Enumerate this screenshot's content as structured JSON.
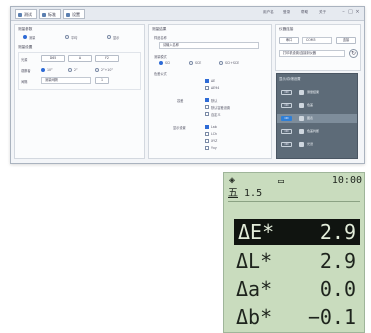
{
  "software": {
    "tabs": [
      "测试",
      "标准",
      "设置"
    ],
    "top_right": [
      "用户名",
      "登录",
      "帮助",
      "关于"
    ],
    "left_panel": {
      "title1": "测量参数",
      "radios": [
        "测量",
        "平均",
        "显示"
      ],
      "title2": "测量设置",
      "rows": [
        {
          "label": "光源",
          "options": [
            "D65",
            "A",
            "F2"
          ]
        },
        {
          "label": "观察者",
          "options": [
            "10°",
            "2°",
            "2°+10°"
          ]
        },
        {
          "label": "间隔",
          "value": "测量间隔",
          "btn": "1"
        }
      ]
    },
    "mid_panel": {
      "title": "测量结果",
      "sub1": "样品名称",
      "field1": "请输入名称",
      "sub2": "测量模式",
      "radios": [
        "SCI",
        "SCE",
        "SCI+SCE"
      ],
      "sub3": "色差公式",
      "opts_a": [
        "ΔE",
        "ΔE94"
      ],
      "opts_b_label": "容差",
      "opts_b": [
        "默认",
        "默认容差设置",
        "自定义"
      ],
      "opts_c_label": "显示设置",
      "opts_c": [
        "Lab",
        "LCh",
        "XYZ",
        "Yxy"
      ]
    },
    "right_panel": {
      "title": "仪器连接",
      "fields": [
        "串口",
        "COM3",
        "连接"
      ],
      "line2": "打印机设置/连接到仪器",
      "dark_title": "显示/存储设置",
      "dark_rows": [
        {
          "key": "ON",
          "label": "测量结果"
        },
        {
          "key": "ON",
          "label": "色差"
        },
        {
          "key": "ON",
          "label": "图表"
        },
        {
          "key": "ON",
          "label": "色差判断"
        },
        {
          "key": "ON",
          "label": "光谱"
        }
      ]
    }
  },
  "device": {
    "signal": "◈",
    "battery": "▭",
    "time": "10:00",
    "mode_prefix": "",
    "mode_char": "五",
    "mode_value": "1.5",
    "measurements": [
      {
        "label": "ΔE*",
        "value": "2.9",
        "highlighted": true
      },
      {
        "label": "ΔL*",
        "value": "2.9",
        "highlighted": false
      },
      {
        "label": "Δa*",
        "value": "0.0",
        "highlighted": false
      },
      {
        "label": "Δb*",
        "value": "−0.1",
        "highlighted": false
      }
    ]
  },
  "colors": {
    "accent": "#2e6bd6",
    "lcd_bg": "#c9dcbe",
    "lcd_text": "#1e241d"
  }
}
